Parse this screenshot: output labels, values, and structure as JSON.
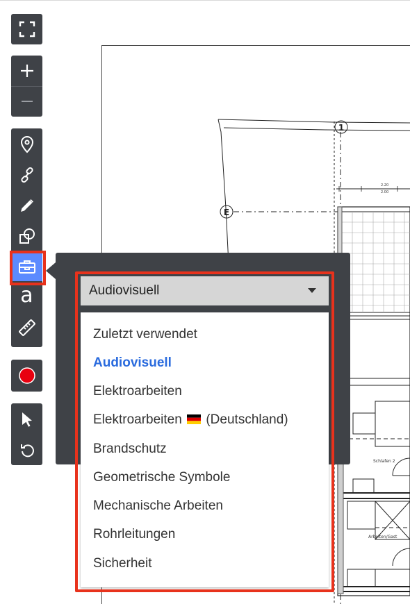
{
  "toolbar": {
    "groups": [
      {
        "id": "view",
        "buttons": [
          {
            "icon": "fullscreen-icon",
            "label": "Fullscreen"
          }
        ]
      },
      {
        "id": "zoom",
        "buttons": [
          {
            "icon": "zoom-in-icon",
            "label": "Zoom in"
          },
          {
            "icon": "zoom-out-icon",
            "label": "Zoom out"
          }
        ]
      },
      {
        "id": "tools",
        "buttons": [
          {
            "icon": "map-pin-icon",
            "label": "Pin"
          },
          {
            "icon": "link-icon",
            "label": "Link"
          },
          {
            "icon": "pencil-icon",
            "label": "Draw"
          },
          {
            "icon": "shapes-icon",
            "label": "Shapes"
          },
          {
            "icon": "toolbox-icon",
            "label": "Symbols",
            "active": true
          },
          {
            "icon": "text-icon",
            "label": "Text",
            "char": "a"
          },
          {
            "icon": "ruler-icon",
            "label": "Measure"
          }
        ]
      },
      {
        "id": "record",
        "buttons": [
          {
            "icon": "record-icon",
            "label": "Record"
          }
        ]
      },
      {
        "id": "history",
        "buttons": [
          {
            "icon": "select-cursor-icon",
            "label": "Select"
          },
          {
            "icon": "undo-icon",
            "label": "Undo"
          }
        ]
      }
    ],
    "active_color": "#5c8bff",
    "background_color": "#3f4247",
    "record_color": "#e8000f"
  },
  "blueprint": {
    "grid_labels": {
      "axis_1": "1",
      "axis_e": "E"
    },
    "room_labels": {
      "room_a": "Schlafen 2",
      "room_b": "Arbeiten/Gast"
    },
    "dimension_labels": {
      "dim_a": "2.20",
      "dim_b": "2.00"
    }
  },
  "symbol_dropdown": {
    "selected": "Audiovisuell",
    "options": [
      {
        "label": "Zuletzt verwendet"
      },
      {
        "label": "Audiovisuell",
        "selected": true
      },
      {
        "label": "Elektroarbeiten"
      },
      {
        "label_before_flag": "Elektroarbeiten",
        "flag": "germany-flag-icon",
        "label_after_flag": "(Deutschland)"
      },
      {
        "label": "Brandschutz"
      },
      {
        "label": "Geometrische Symbole"
      },
      {
        "label": "Mechanische Arbeiten"
      },
      {
        "label": "Rohrleitungen"
      },
      {
        "label": "Sicherheit"
      }
    ],
    "selected_color": "#2a6bde",
    "highlight_color": "#e8321c"
  }
}
